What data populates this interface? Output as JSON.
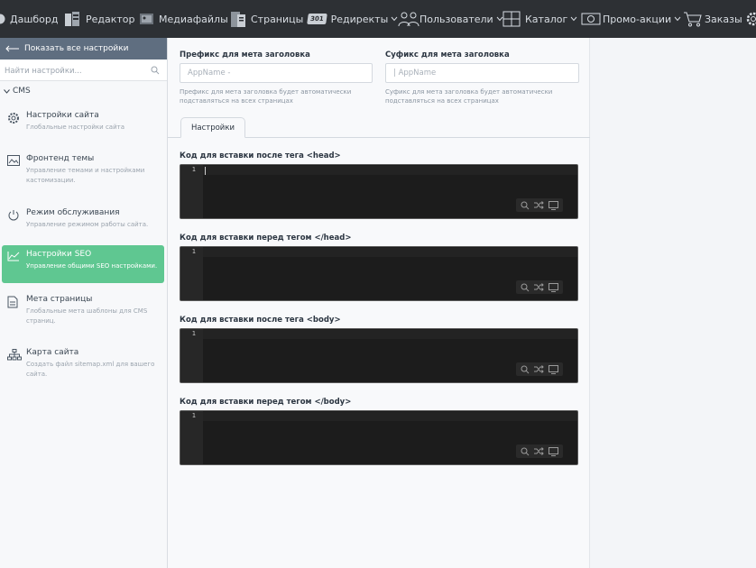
{
  "nav": {
    "items": [
      {
        "label": "Дашборд",
        "icon": "dashboard-icon"
      },
      {
        "label": "Редактор",
        "icon": "editor-icon"
      },
      {
        "label": "Медиафайлы",
        "icon": "media-icon"
      },
      {
        "label": "Страницы",
        "icon": "pages-icon"
      },
      {
        "label": "Редиректы",
        "icon": "redirects-icon",
        "badge": "301",
        "dropdown": true
      },
      {
        "label": "Пользователи",
        "icon": "users-icon",
        "dropdown": true
      },
      {
        "label": "Каталог",
        "icon": "catalog-icon",
        "dropdown": true
      },
      {
        "label": "Промо-акции",
        "icon": "promo-icon",
        "dropdown": true
      },
      {
        "label": "Заказы",
        "icon": "cart-icon"
      }
    ]
  },
  "sidebar": {
    "back_label": "Показать все настройки",
    "search_placeholder": "Найти настройки...",
    "group_label": "CMS",
    "items": [
      {
        "title": "Настройки сайта",
        "desc": "Глобальные настройки сайта",
        "icon": "gear-icon",
        "active": false
      },
      {
        "title": "Фронтенд темы",
        "desc": "Управление темами и настройками кастомизации.",
        "icon": "image-icon",
        "active": false
      },
      {
        "title": "Режим обслуживания",
        "desc": "Управление режимом работы сайта.",
        "icon": "power-icon",
        "active": false
      },
      {
        "title": "Настройки SEO",
        "desc": "Управление общими SEO настройками.",
        "icon": "chart-line-icon",
        "active": true
      },
      {
        "title": "Мета страницы",
        "desc": "Глобальные мета шаблоны для CMS страниц.",
        "icon": "document-icon",
        "active": false
      },
      {
        "title": "Карта сайта",
        "desc": "Создать файл sitemap.xml для вашего сайта.",
        "icon": "sitemap-icon",
        "active": false
      }
    ]
  },
  "form": {
    "prefix": {
      "label": "Префикс для мета заголовка",
      "placeholder": "AppName -",
      "help": "Префикс для мета заголовка будет автоматически подставляться на всех страницах"
    },
    "suffix": {
      "label": "Суфикс для мета заголовка",
      "placeholder": "| AppName",
      "help": "Суфикс для мета заголовка будет автоматически подставляться на всех страницах"
    },
    "tab_label": "Настройки",
    "code_fields": [
      {
        "label": "Код для вставки после тега <head>",
        "line": "1"
      },
      {
        "label": "Код для вставки перед тегом </head>",
        "line": "1"
      },
      {
        "label": "Код для вставки после тега <body>",
        "line": "1"
      },
      {
        "label": "Код для вставки перед тегом </body>",
        "line": "1"
      }
    ]
  },
  "colors": {
    "topbar": "#2d3034",
    "back_bar": "#5f6e80",
    "active_item": "#5fc791",
    "editor_bg": "#1c1c1c"
  }
}
